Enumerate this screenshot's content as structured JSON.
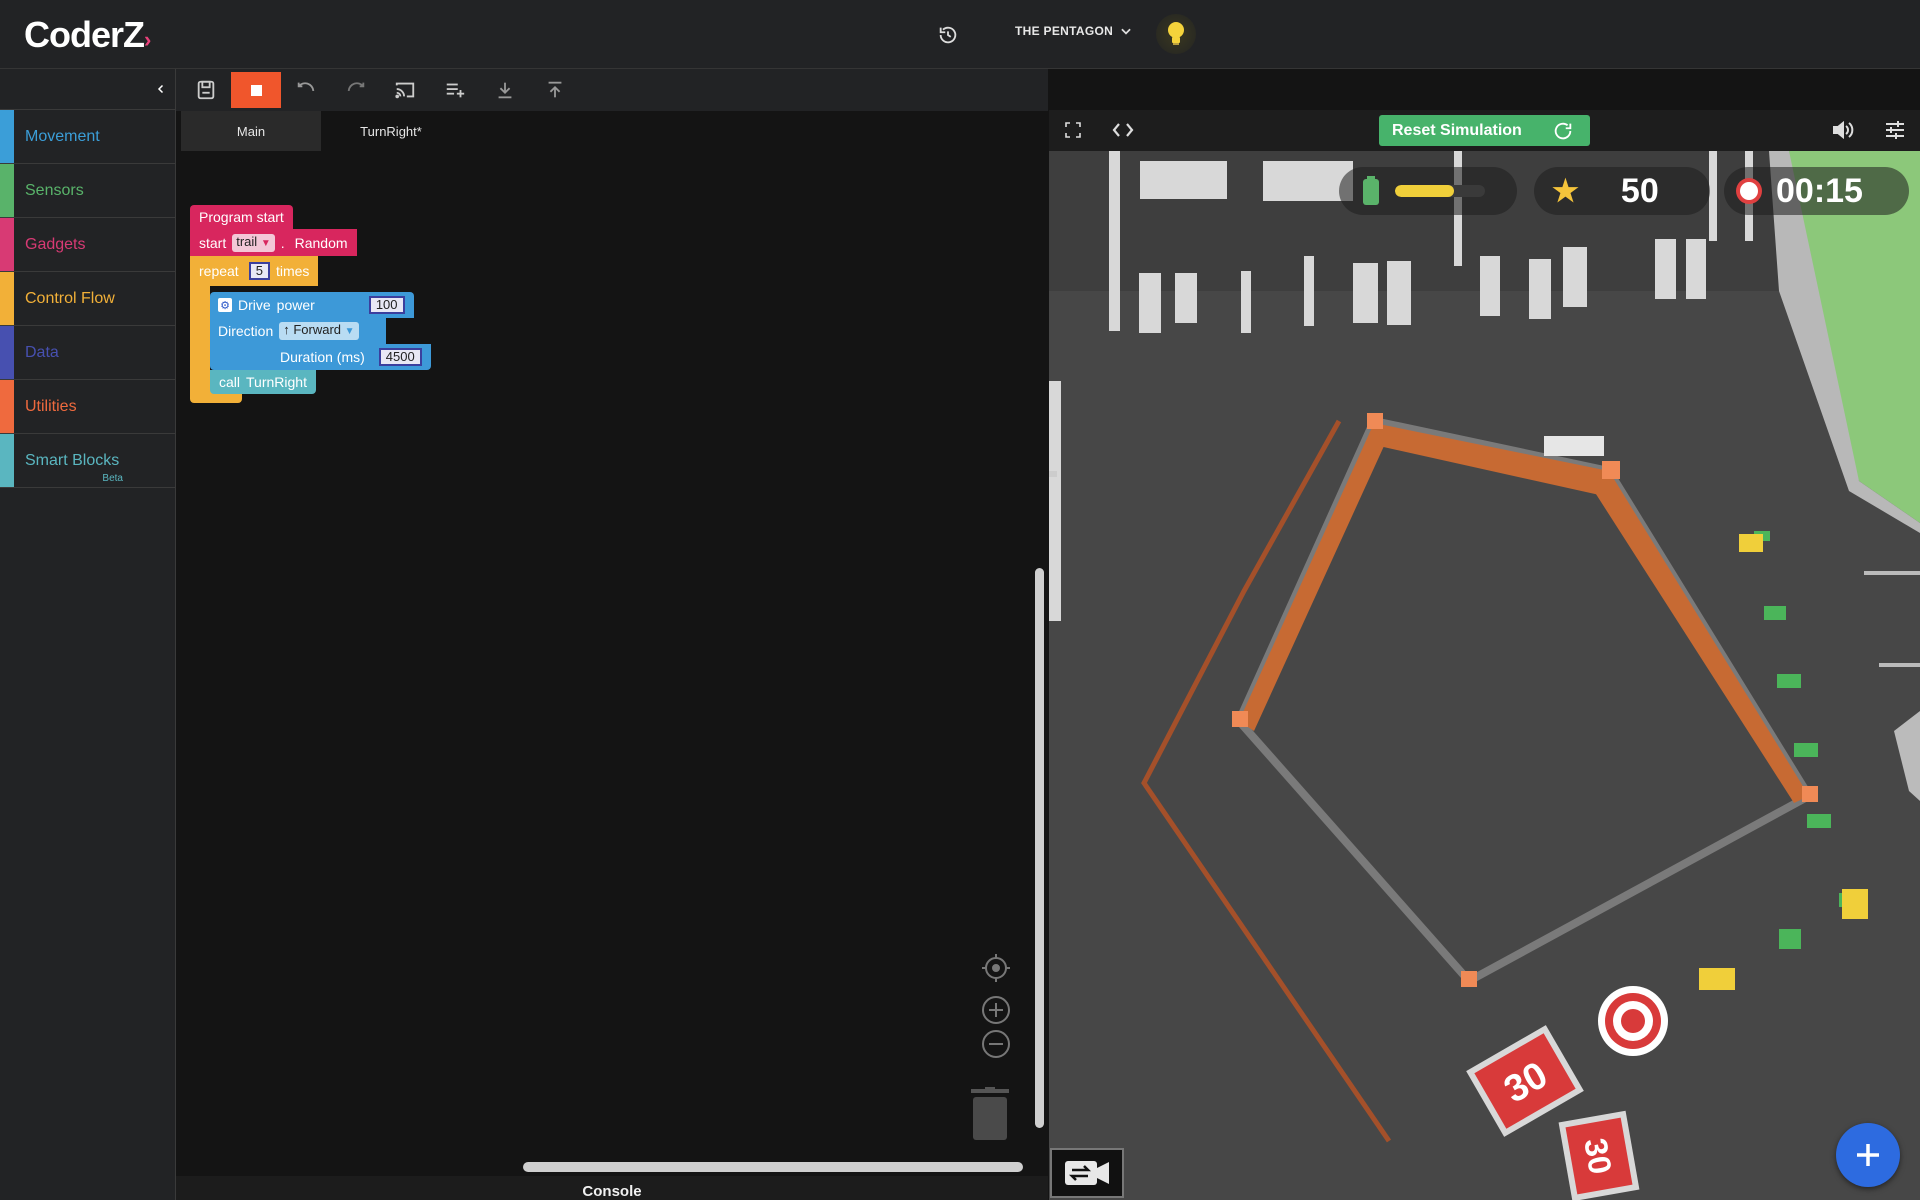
{
  "app": {
    "logo": "CoderZ"
  },
  "header": {
    "mission": "THE PENTAGON"
  },
  "sidebar": {
    "categories": [
      {
        "label": "Movement",
        "color": "#3b9ed8"
      },
      {
        "label": "Sensors",
        "color": "#59b36a"
      },
      {
        "label": "Gadgets",
        "color": "#d83a74"
      },
      {
        "label": "Control Flow",
        "color": "#f2b038"
      },
      {
        "label": "Data",
        "color": "#4750b0"
      },
      {
        "label": "Utilities",
        "color": "#ef6a3e"
      },
      {
        "label": "Smart Blocks",
        "color": "#5ab6c0"
      }
    ],
    "beta": "Beta"
  },
  "tabs": [
    "Main",
    "TurnRight*"
  ],
  "blocks": {
    "program_start": "Program start",
    "start_kw": "start",
    "trail": "trail",
    "dot": ".",
    "random": "Random",
    "repeat": "repeat",
    "repeat_count": "5",
    "times": "times",
    "drive": "Drive",
    "power": "power",
    "power_value": "100",
    "direction": "Direction",
    "direction_value": "↑ Forward",
    "duration": "Duration (ms)",
    "duration_value": "4500",
    "call": "call",
    "call_target": "TurnRight"
  },
  "console": "Console",
  "simulation": {
    "reset_label": "Reset Simulation",
    "score": "50",
    "timer": "00:15",
    "battery_level": 0.65,
    "sign_label": "30"
  }
}
